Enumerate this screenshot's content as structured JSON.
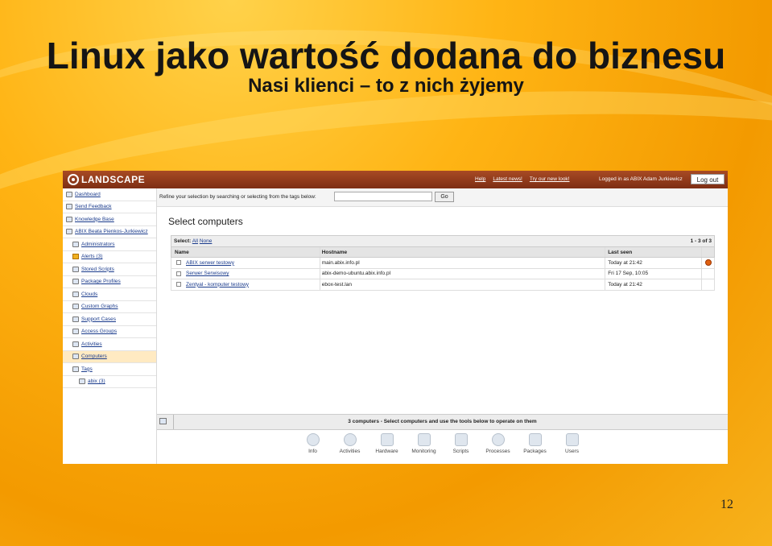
{
  "slide": {
    "title": "Linux jako wartość dodana do biznesu",
    "subtitle": "Nasi klienci – to z nich żyjemy",
    "page_number": "12"
  },
  "app": {
    "logo_text": "LANDSCAPE",
    "top_links": [
      "Help",
      "Latest news!",
      "Try our new look!"
    ],
    "logged_in_text": "Logged in as ABIX Adam Jurkiewicz",
    "logout_label": "Log out"
  },
  "sidebar": {
    "items": [
      {
        "label": "Dashboard"
      },
      {
        "label": "Send Feedback"
      },
      {
        "label": "Knowledge Base"
      },
      {
        "label": "ABIX Beata Pienkos-Jurkiewicz"
      },
      {
        "label": "Administrators"
      },
      {
        "label": "Alerts (3)"
      },
      {
        "label": "Stored Scripts"
      },
      {
        "label": "Package Profiles"
      },
      {
        "label": "Clouds"
      },
      {
        "label": "Custom Graphs"
      },
      {
        "label": "Support Cases"
      },
      {
        "label": "Access Groups"
      },
      {
        "label": "Activities"
      },
      {
        "label": "Computers"
      },
      {
        "label": "Tags"
      },
      {
        "label": "abix (3)"
      }
    ]
  },
  "refine": {
    "label": "Refine your selection by searching or selecting from the tags below:",
    "input_value": "",
    "go_label": "Go"
  },
  "main": {
    "title": "Select computers",
    "select_label": "Select:",
    "select_all": "All",
    "select_none": "None",
    "pagination": "1 - 3 of 3",
    "columns": [
      "Name",
      "Hostname",
      "Last seen"
    ],
    "rows": [
      {
        "name": "ABIX serwer testowy",
        "hostname": "main.abix.info.pl",
        "last_seen": "Today at 21:42"
      },
      {
        "name": "Serwer Serwisowy",
        "hostname": "abix-demo-ubuntu.abix.info.pl",
        "last_seen": "Fri 17 Sep, 10:05"
      },
      {
        "name": "Zentyal - komputer testowy",
        "hostname": "ebox-test.lan",
        "last_seen": "Today at 21:42"
      }
    ]
  },
  "status_bar": {
    "text": "3 computers - Select computers and use the tools below to operate on them"
  },
  "toolbar": {
    "items": [
      "Info",
      "Activities",
      "Hardware",
      "Monitoring",
      "Scripts",
      "Processes",
      "Packages",
      "Users"
    ]
  }
}
